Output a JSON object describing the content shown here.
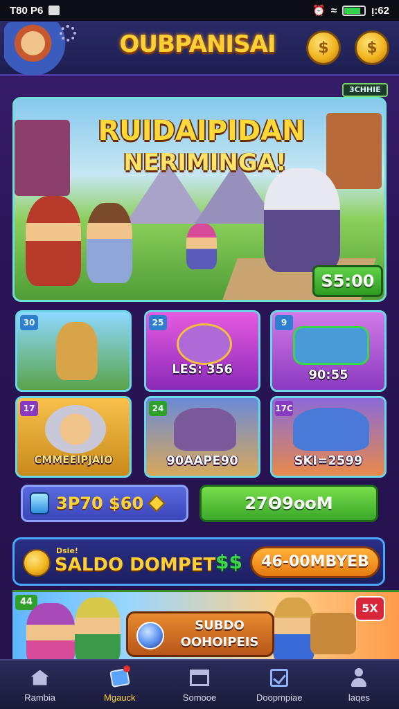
{
  "status_bar": {
    "time_left": "T80 P6",
    "time_right": "ᴉ:62"
  },
  "header": {
    "app_title": "OUBPANISAI",
    "avatar_icon": "hero-avatar-icon",
    "coin_icon_1": "coin-icon",
    "coin_icon_2": "coin-icon"
  },
  "hero": {
    "tag": "3CHHIE",
    "title": "RUIDAIPIDAN",
    "subtitle": "NERIMINGA!",
    "price": "S5:00"
  },
  "tiles": [
    {
      "badge": "30",
      "caption": "",
      "theme": "#7fd6ff"
    },
    {
      "badge": "25",
      "caption": "LES: 356",
      "theme": "#c13ad8"
    },
    {
      "badge": "9",
      "caption": "90:55",
      "theme": "#c35bde"
    },
    {
      "badge": "17",
      "caption": "CMMEEIPJAIO",
      "theme": "#f1a82e"
    },
    {
      "badge": "24",
      "caption": "90AAPE90",
      "theme": "#5a6fc8"
    },
    {
      "badge": "17C",
      "caption": "SKI=2599",
      "theme": "#6a4ac0"
    }
  ],
  "actions": {
    "price_label": "3P70 $60",
    "green_button": "27Θ9ooM"
  },
  "wallet": {
    "note": "Dsie!",
    "label": "SALDO DOMPET",
    "cash_icon": "$$",
    "amount_button": "46-00MBYEB"
  },
  "promo": {
    "badge": "44",
    "x_badge": "5X",
    "button_line1": "SUBDO",
    "button_line2": "OOHOIPEIS"
  },
  "nav": [
    {
      "label": "Rambia",
      "icon": "home-icon"
    },
    {
      "label": "Mgauck",
      "icon": "box-icon"
    },
    {
      "label": "Somooe",
      "icon": "shop-icon"
    },
    {
      "label": "Doopmpiae",
      "icon": "check-icon"
    },
    {
      "label": "laqes",
      "icon": "user-icon"
    }
  ]
}
